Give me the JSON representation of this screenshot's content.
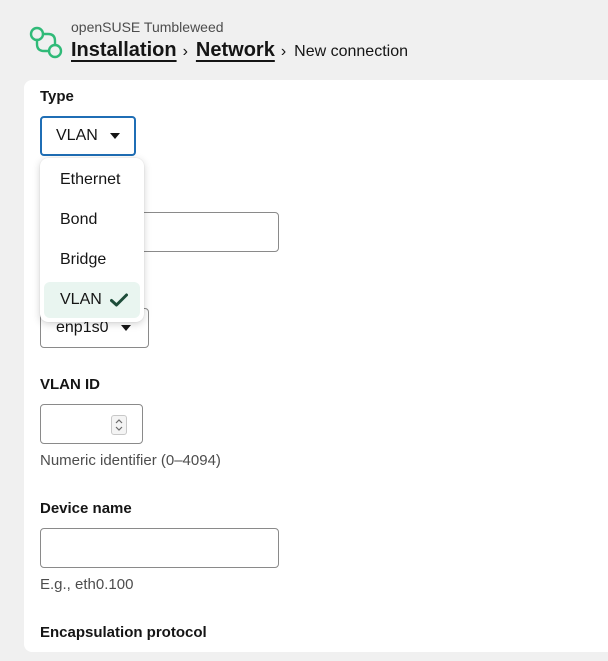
{
  "header": {
    "product": "openSUSE Tumbleweed",
    "breadcrumbs": [
      {
        "label": "Installation"
      },
      {
        "label": "Network"
      },
      {
        "label": "New connection"
      }
    ],
    "separator": "›"
  },
  "form": {
    "type": {
      "label": "Type",
      "value": "VLAN"
    },
    "parent": {
      "value": "enp1s0"
    },
    "vlan_id": {
      "label": "VLAN ID",
      "value": "",
      "helper": "Numeric identifier (0–4094)"
    },
    "device_name": {
      "label": "Device name",
      "value": "",
      "helper": "E.g., eth0.100"
    },
    "encapsulation": {
      "label": "Encapsulation protocol"
    }
  },
  "type_menu": {
    "items": [
      {
        "label": "Ethernet",
        "selected": false
      },
      {
        "label": "Bond",
        "selected": false
      },
      {
        "label": "Bridge",
        "selected": false
      },
      {
        "label": "VLAN",
        "selected": true
      }
    ]
  },
  "colors": {
    "brand_green": "#30ba78",
    "focus_blue": "#1f6eb5",
    "selected_bg": "#e9f5f0",
    "check": "#1e4d3a"
  },
  "icons": {
    "logo": "opensuse-logo-icon",
    "caret": "caret-down-icon",
    "check": "checkmark-icon",
    "spinner": "spinner-arrows-icon"
  }
}
